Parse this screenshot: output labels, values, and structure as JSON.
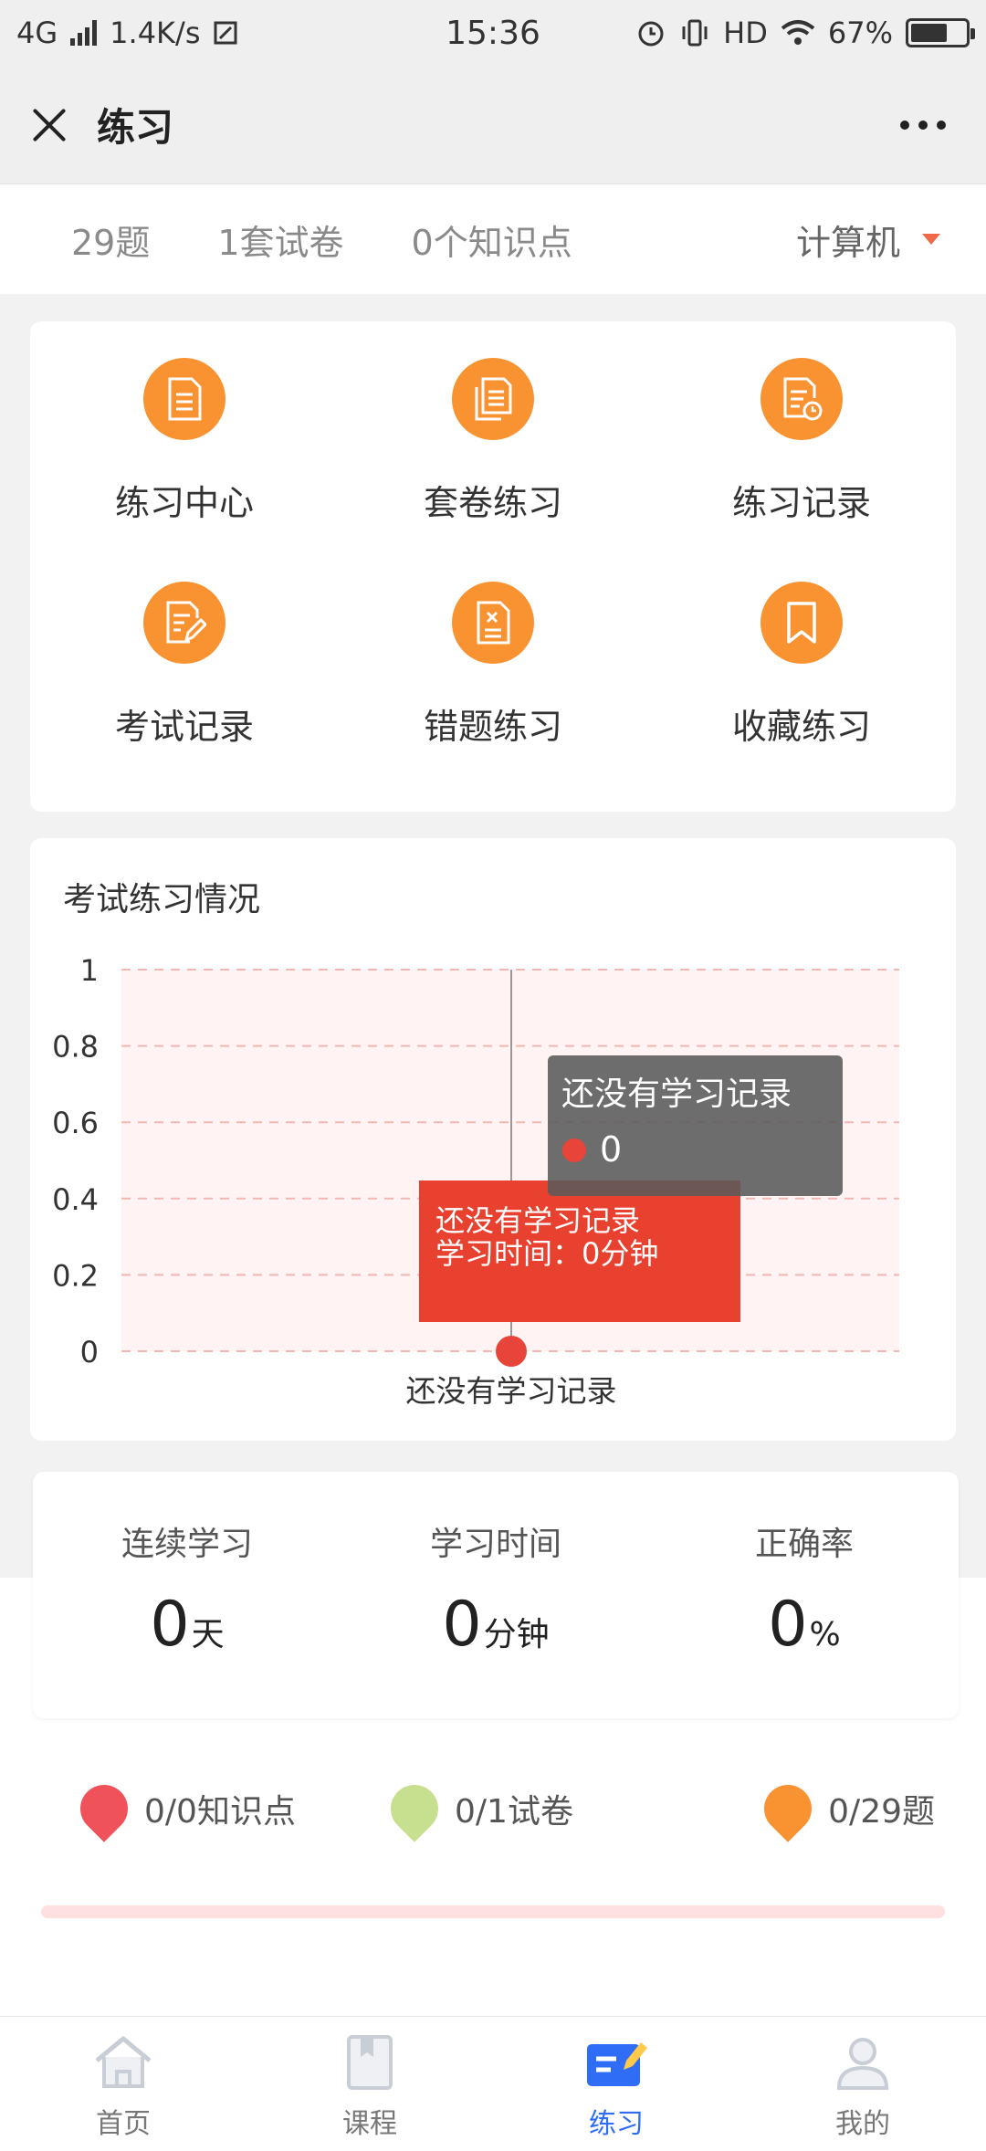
{
  "status_bar": {
    "network": "4G",
    "speed": "1.4K/s",
    "time": "15:36",
    "hd": "HD",
    "battery": "67%",
    "battery_level": 0.67
  },
  "nav": {
    "title": "练习"
  },
  "summary": {
    "questions": "29题",
    "papers": "1套试卷",
    "points": "0个知识点",
    "subject": "计算机"
  },
  "grid": {
    "items": [
      {
        "label": "练习中心",
        "icon": "document-icon"
      },
      {
        "label": "套卷练习",
        "icon": "documents-icon"
      },
      {
        "label": "练习记录",
        "icon": "document-clock-icon"
      },
      {
        "label": "考试记录",
        "icon": "document-edit-icon"
      },
      {
        "label": "错题练习",
        "icon": "document-x-icon"
      },
      {
        "label": "收藏练习",
        "icon": "bookmark-icon"
      }
    ]
  },
  "chart_card": {
    "title": "考试练习情况"
  },
  "chart_data": {
    "type": "scatter",
    "title": "考试练习情况",
    "categories": [
      "还没有学习记录"
    ],
    "series": [
      {
        "values": [
          0
        ]
      }
    ],
    "ylim": [
      0,
      1
    ],
    "yticks": [
      "1",
      "0.8",
      "0.6",
      "0.4",
      "0.2",
      "0"
    ],
    "tooltip": {
      "title": "还没有学习记录",
      "value": "0"
    },
    "annotation": {
      "line1": "还没有学习记录",
      "line2": "学习时间：0分钟"
    },
    "grid": true,
    "colors": {
      "point": "#e9443a",
      "annotation_bg": "#e9412f",
      "band": "#fff3f3"
    }
  },
  "stats": [
    {
      "label": "连续学习",
      "value": "0",
      "unit": "天"
    },
    {
      "label": "学习时间",
      "value": "0",
      "unit": "分钟"
    },
    {
      "label": "正确率",
      "value": "0",
      "unit": "%"
    }
  ],
  "legend": [
    {
      "text": "0/0知识点",
      "color": "#f0525a"
    },
    {
      "text": "0/1试卷",
      "color": "#c7e08f"
    },
    {
      "text": "0/29题",
      "color": "#f99231"
    }
  ],
  "tabbar": {
    "items": [
      {
        "label": "首页",
        "icon": "home-icon",
        "active": false
      },
      {
        "label": "课程",
        "icon": "book-icon",
        "active": false
      },
      {
        "label": "练习",
        "icon": "practice-icon",
        "active": true
      },
      {
        "label": "我的",
        "icon": "user-icon",
        "active": false
      }
    ]
  }
}
